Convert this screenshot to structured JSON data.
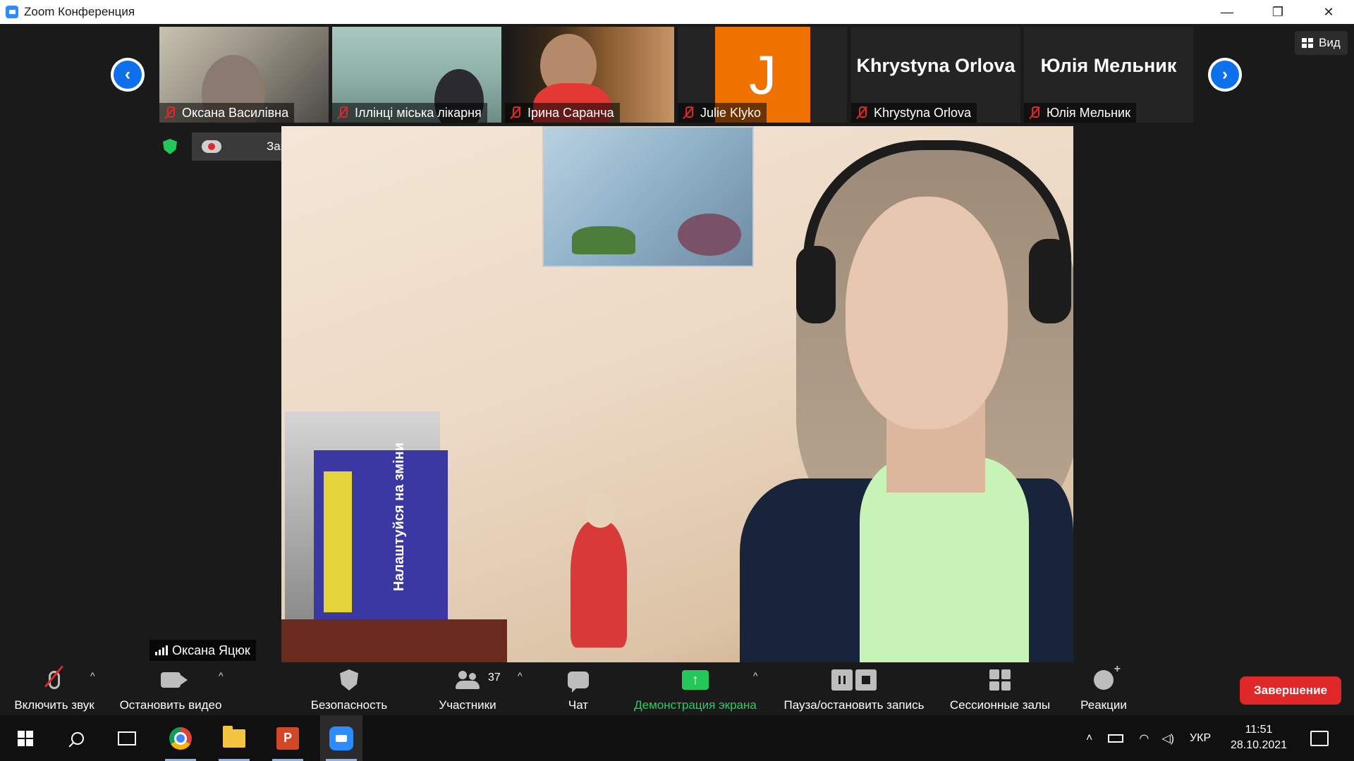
{
  "window": {
    "title": "Zoom Конференция",
    "controls": [
      "—",
      "❐",
      "✕"
    ]
  },
  "view_button": {
    "label": "Вид"
  },
  "thumbnails": [
    {
      "name": "Оксана Василівна",
      "muted": true,
      "type": "video"
    },
    {
      "name": "Іллінці міська лікарня",
      "muted": true,
      "type": "video"
    },
    {
      "name": "Ірина Саранча",
      "muted": true,
      "type": "video"
    },
    {
      "name": "Julie Klyko",
      "muted": true,
      "type": "avatar",
      "avatar_letter": "J",
      "avatar_color": "#ef7200"
    },
    {
      "name": "Khrystyna Orlova",
      "muted": true,
      "type": "name",
      "big_name": "Khrystyna Orlova"
    },
    {
      "name": "Юлія Мельник",
      "muted": true,
      "type": "name",
      "big_name": "Юлія Мельник"
    }
  ],
  "recording": {
    "label": "Запись..."
  },
  "main_video": {
    "speaker": "Оксана Яцюк",
    "book_title": "Налаштуйся на зміни"
  },
  "toolbar": {
    "unmute": "Включить звук",
    "stop_video": "Остановить видео",
    "security": "Безопасность",
    "participants": "Участники",
    "participants_count": "37",
    "chat": "Чат",
    "share_screen": "Демонстрация экрана",
    "pause_stop_recording": "Пауза/остановить запись",
    "breakout_rooms": "Сессионные залы",
    "reactions": "Реакции",
    "end": "Завершение"
  },
  "taskbar": {
    "language": "УКР",
    "time": "11:51",
    "date": "28.10.2021"
  },
  "colors": {
    "accent_blue": "#0e71eb",
    "end_red": "#e02828",
    "share_green": "#24c75a",
    "avatar_orange": "#ef7200"
  }
}
